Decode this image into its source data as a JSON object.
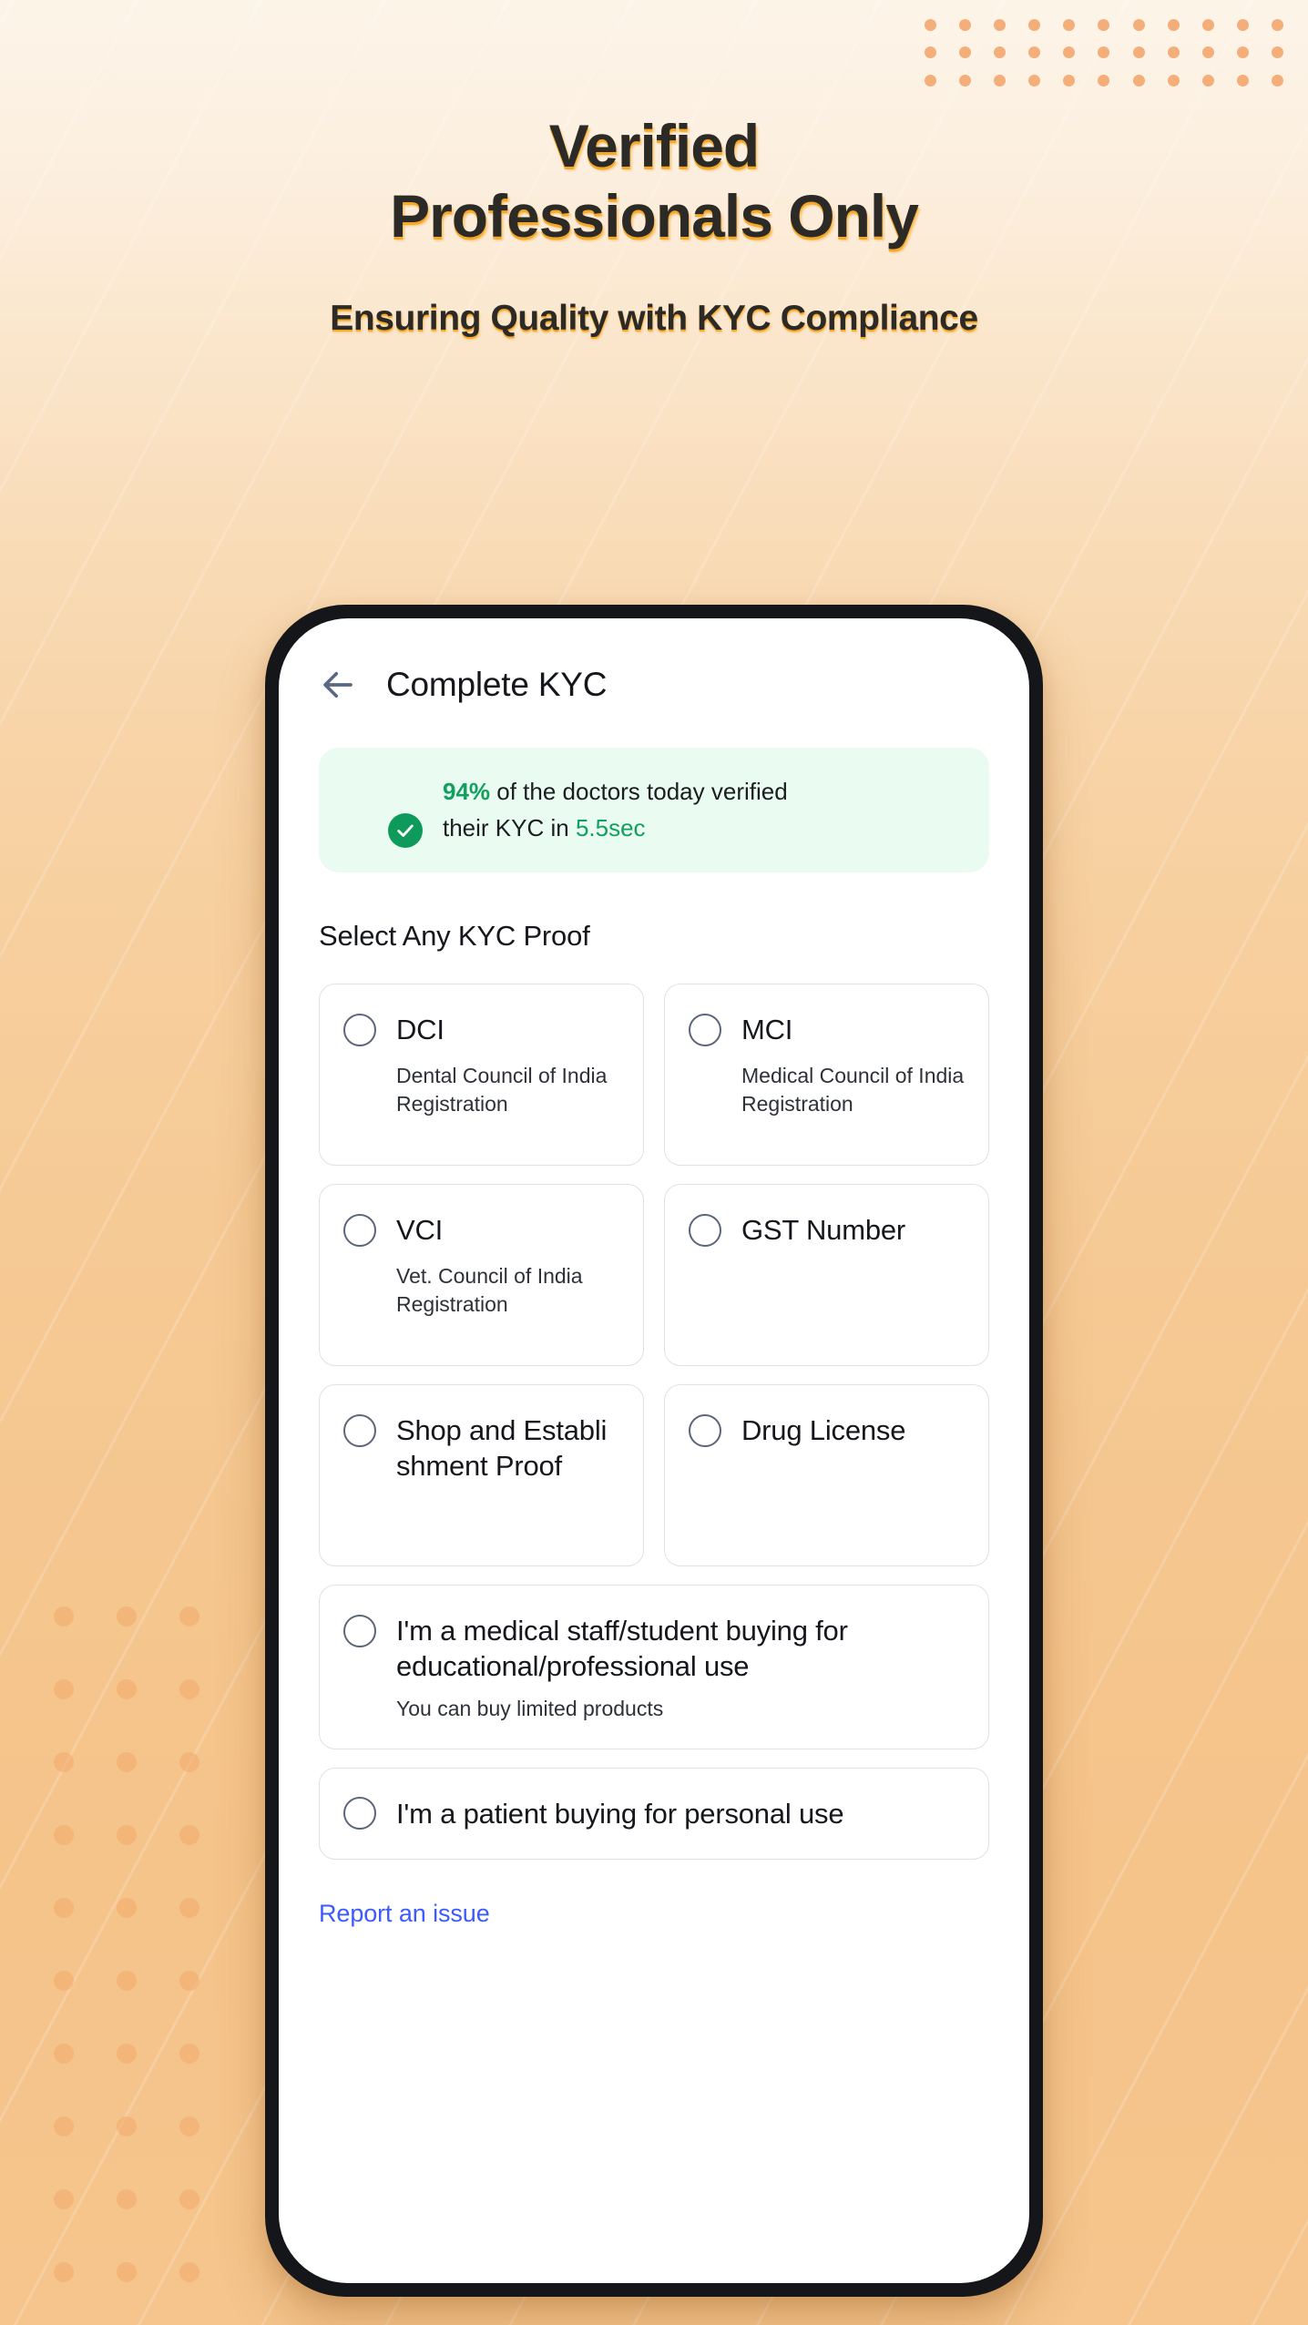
{
  "hero": {
    "headline_line1": "Verified",
    "headline_line2": "Professionals Only",
    "subheadline": "Ensuring Quality with KYC Compliance"
  },
  "phone": {
    "header": {
      "back_icon": "back-arrow-icon",
      "title": "Complete KYC"
    },
    "banner": {
      "avatar_icon": "doctor-avatar",
      "badge_icon": "check-icon",
      "percent": "94%",
      "text_part1": " of the doctors today verified",
      "text_part2": "their KYC in ",
      "duration": "5.5sec"
    },
    "section_title": "Select Any KYC Proof",
    "options": [
      {
        "label": "DCI",
        "sub": "Dental Council of India Registration"
      },
      {
        "label": "MCI",
        "sub": "Medical Council of India Registration"
      },
      {
        "label": "VCI",
        "sub": "Vet. Council of India Registration"
      },
      {
        "label": "GST Number",
        "sub": ""
      },
      {
        "label": "Shop and Establishment Proof",
        "sub": ""
      },
      {
        "label": "Drug License",
        "sub": ""
      }
    ],
    "wide_options": [
      {
        "label": "I'm a medical staff/student buying for educational/professional use",
        "note": "You can buy limited products"
      },
      {
        "label": "I'm a patient buying for personal use",
        "note": ""
      }
    ],
    "report_link": "Report an issue"
  },
  "colors": {
    "accent_orange": "#F5A623",
    "text_dark": "#2B2A26",
    "banner_bg": "#EAFBF1",
    "green": "#12A05E",
    "badge_green": "#0E9A5A",
    "link_blue": "#3D5AFE",
    "card_border": "#DDE1E8",
    "radio_border": "#5B6578",
    "bezel": "#15161A"
  }
}
